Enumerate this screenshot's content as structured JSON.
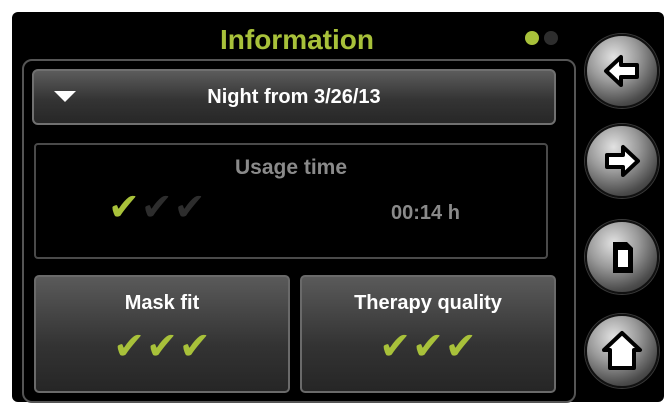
{
  "header": {
    "title": "Information",
    "page_indicator": {
      "total": 2,
      "active": 1
    }
  },
  "night_selector": {
    "label": "Night from 3/26/13",
    "icon": "triangle-down-icon"
  },
  "usage": {
    "label": "Usage time",
    "value": "00:14 h",
    "rating": 1,
    "rating_max": 3
  },
  "tiles": {
    "mask_fit": {
      "label": "Mask fit",
      "rating": 3,
      "rating_max": 3
    },
    "therapy_quality": {
      "label": "Therapy quality",
      "rating": 3,
      "rating_max": 3
    }
  },
  "nav": {
    "back_icon": "arrow-left-icon",
    "forward_icon": "arrow-right-icon",
    "card_icon": "sd-card-icon",
    "home_icon": "home-icon"
  },
  "colors": {
    "accent": "#a8c13a",
    "background": "#000000",
    "dim_text": "#8a8a8a"
  }
}
